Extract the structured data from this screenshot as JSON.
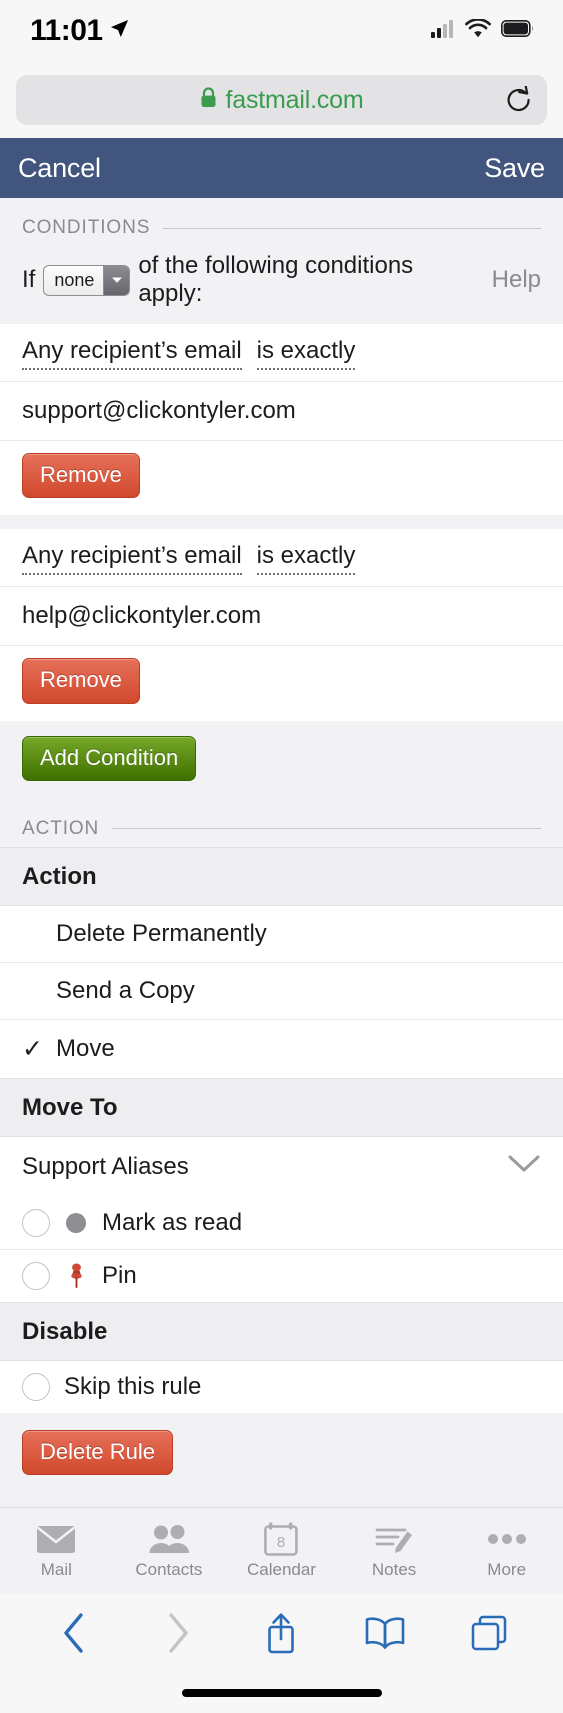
{
  "status_bar": {
    "time": "11:01",
    "location_icon": "location-arrow-icon",
    "cellular_icon": "cellular-bars-icon",
    "wifi_icon": "wifi-icon",
    "battery_icon": "battery-icon"
  },
  "browser": {
    "url": "fastmail.com",
    "lock_icon": "lock-icon",
    "reload_icon": "reload-icon",
    "toolbar": {
      "back_icon": "chevron-left-icon",
      "forward_icon": "chevron-right-icon",
      "share_icon": "share-icon",
      "bookmarks_icon": "book-icon",
      "tabs_icon": "tabs-icon"
    },
    "colors": {
      "active_blue": "#2b6cb8",
      "disabled_gray": "#c4c4c8"
    }
  },
  "app_header": {
    "cancel_label": "Cancel",
    "save_label": "Save",
    "background": "#42557f"
  },
  "conditions": {
    "section_label": "CONDITIONS",
    "if_prefix": "If",
    "match_select_value": "none",
    "if_suffix": "of the following conditions apply:",
    "help_label": "Help",
    "items": [
      {
        "field": "Any recipient’s email",
        "operator": "is exactly",
        "value": "support@clickontyler.com",
        "remove_label": "Remove"
      },
      {
        "field": "Any recipient’s email",
        "operator": "is exactly",
        "value": "help@clickontyler.com",
        "remove_label": "Remove"
      }
    ],
    "add_label": "Add Condition"
  },
  "action": {
    "section_label": "ACTION",
    "group_label": "Action",
    "options": [
      {
        "label": "Delete Permanently",
        "checked": false
      },
      {
        "label": "Send a Copy",
        "checked": false
      },
      {
        "label": "Move",
        "checked": true
      }
    ],
    "check_glyph": "✓",
    "move_to": {
      "group_label": "Move To",
      "folder": "Support Aliases",
      "chevron_icon": "chevron-down-icon"
    },
    "flags": [
      {
        "label": "Mark as read",
        "icon": "gray-dot-icon",
        "checked": false
      },
      {
        "label": "Pin",
        "icon": "pushpin-icon",
        "checked": false
      }
    ]
  },
  "disable": {
    "group_label": "Disable",
    "skip_label": "Skip this rule",
    "skip_checked": false,
    "delete_label": "Delete Rule"
  },
  "tabbar": {
    "items": [
      {
        "label": "Mail",
        "icon": "envelope-icon"
      },
      {
        "label": "Contacts",
        "icon": "people-icon"
      },
      {
        "label": "Calendar",
        "icon": "calendar-icon",
        "day": "8"
      },
      {
        "label": "Notes",
        "icon": "notes-pencil-icon"
      },
      {
        "label": "More",
        "icon": "ellipsis-icon"
      }
    ]
  },
  "colors": {
    "header_blue": "#42557f",
    "url_green": "#3b9b4e",
    "button_red": "#d1492c",
    "button_green": "#3e7000",
    "pin_red": "#c0392b",
    "page_bg": "#f2f2f4"
  }
}
